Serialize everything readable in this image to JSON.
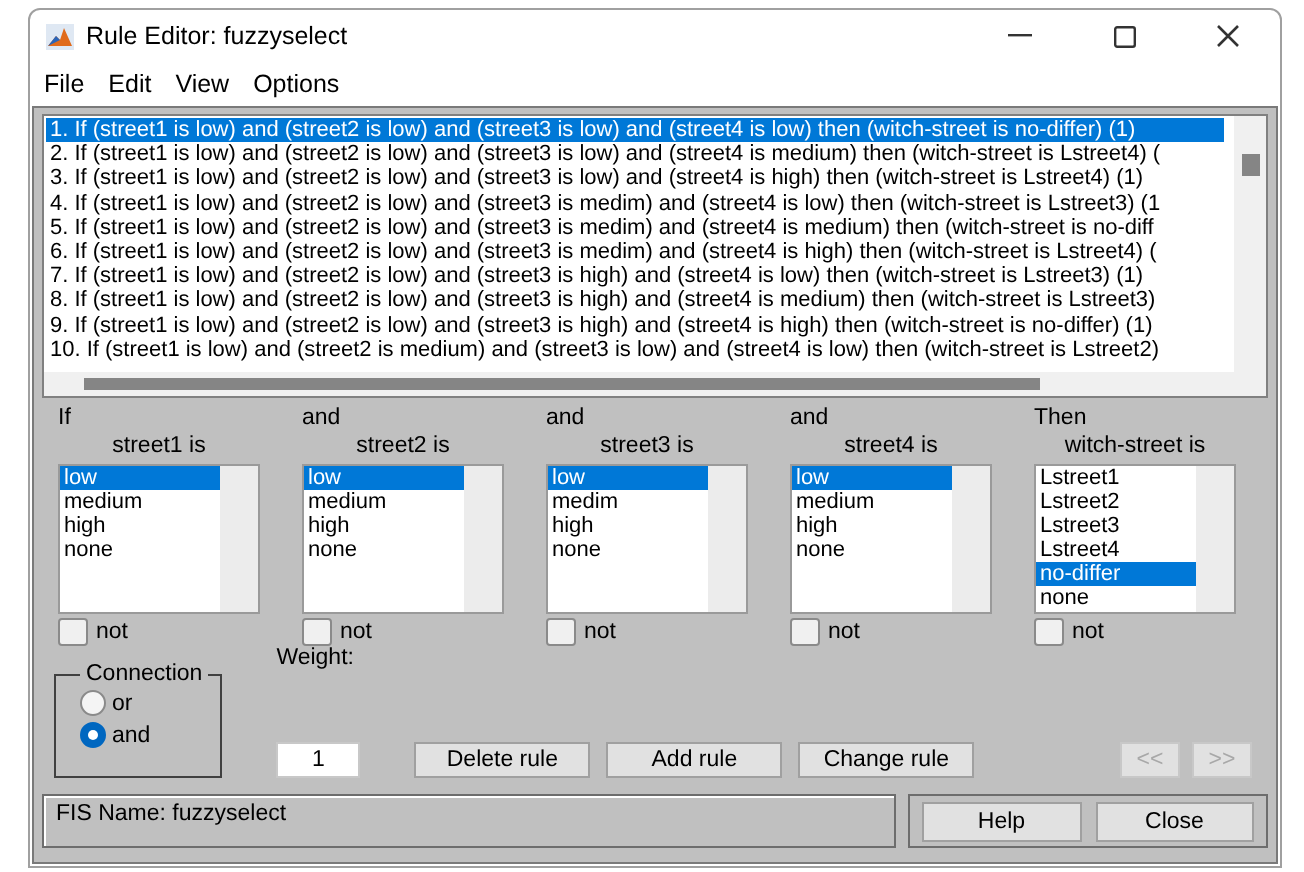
{
  "window": {
    "title": "Rule Editor: fuzzyselect"
  },
  "menu": [
    "File",
    "Edit",
    "View",
    "Options"
  ],
  "rules": [
    {
      "text": "1. If (street1 is low) and (street2 is low) and (street3 is low) and (street4 is low) then (witch-street is no-differ) (1)",
      "selected": true
    },
    {
      "text": "2. If (street1 is low) and (street2 is low) and (street3 is low) and (street4 is medium) then (witch-street is Lstreet4) (",
      "selected": false
    },
    {
      "text": "3. If (street1 is low) and (street2 is low) and (street3 is low) and (street4 is high) then (witch-street is Lstreet4) (1)",
      "selected": false
    },
    {
      "text": "4. If (street1 is low) and (street2 is low) and (street3 is medim) and (street4 is low) then (witch-street is Lstreet3) (1",
      "selected": false
    },
    {
      "text": "5. If (street1 is low) and (street2 is low) and (street3 is medim) and (street4 is medium) then (witch-street is no-diff",
      "selected": false
    },
    {
      "text": "6. If (street1 is low) and (street2 is low) and (street3 is medim) and (street4 is high) then (witch-street is Lstreet4) (",
      "selected": false
    },
    {
      "text": "7. If (street1 is low) and (street2 is low) and (street3 is high) and (street4 is low) then (witch-street is Lstreet3) (1)",
      "selected": false
    },
    {
      "text": "8. If (street1 is low) and (street2 is low) and (street3 is high) and (street4 is medium) then (witch-street is Lstreet3)",
      "selected": false
    },
    {
      "text": "9. If (street1 is low) and (street2 is low) and (street3 is high) and (street4 is high) then (witch-street is no-differ) (1)",
      "selected": false
    },
    {
      "text": "10. If (street1 is low) and (street2 is medium) and (street3 is low) and (street4 is low) then (witch-street is Lstreet2)",
      "selected": false
    }
  ],
  "columns": [
    {
      "connector": "If",
      "variable": "street1 is",
      "items": [
        {
          "label": "low",
          "selected": true
        },
        {
          "label": "medium",
          "selected": false
        },
        {
          "label": "high",
          "selected": false
        },
        {
          "label": "none",
          "selected": false
        }
      ],
      "not": {
        "label": "not",
        "checked": false
      }
    },
    {
      "connector": "and",
      "variable": "street2 is",
      "items": [
        {
          "label": "low",
          "selected": true
        },
        {
          "label": "medium",
          "selected": false
        },
        {
          "label": "high",
          "selected": false
        },
        {
          "label": "none",
          "selected": false
        }
      ],
      "not": {
        "label": "not",
        "checked": false
      }
    },
    {
      "connector": "and",
      "variable": "street3 is",
      "items": [
        {
          "label": "low",
          "selected": true
        },
        {
          "label": "medim",
          "selected": false
        },
        {
          "label": "high",
          "selected": false
        },
        {
          "label": "none",
          "selected": false
        }
      ],
      "not": {
        "label": "not",
        "checked": false
      }
    },
    {
      "connector": "and",
      "variable": "street4 is",
      "items": [
        {
          "label": "low",
          "selected": true
        },
        {
          "label": "medium",
          "selected": false
        },
        {
          "label": "high",
          "selected": false
        },
        {
          "label": "none",
          "selected": false
        }
      ],
      "not": {
        "label": "not",
        "checked": false
      }
    },
    {
      "connector": "Then",
      "variable": "witch-street is",
      "items": [
        {
          "label": "Lstreet1",
          "selected": false
        },
        {
          "label": "Lstreet2",
          "selected": false
        },
        {
          "label": "Lstreet3",
          "selected": false
        },
        {
          "label": "Lstreet4",
          "selected": false
        },
        {
          "label": "no-differ",
          "selected": true
        },
        {
          "label": "none",
          "selected": false
        }
      ],
      "not": {
        "label": "not",
        "checked": false
      }
    }
  ],
  "connection": {
    "label": "Connection",
    "options": [
      {
        "label": "or",
        "selected": false
      },
      {
        "label": "and",
        "selected": true
      }
    ]
  },
  "weight": {
    "label": "Weight:",
    "value": "1"
  },
  "buttons": [
    {
      "label": "Delete rule",
      "disabled": false
    },
    {
      "label": "Add rule",
      "disabled": false
    },
    {
      "label": "Change rule",
      "disabled": false
    },
    {
      "label": "<<",
      "disabled": true
    },
    {
      "label": ">>",
      "disabled": true
    }
  ],
  "status": "FIS Name: fuzzyselect",
  "footer_buttons": [
    "Help",
    "Close"
  ]
}
